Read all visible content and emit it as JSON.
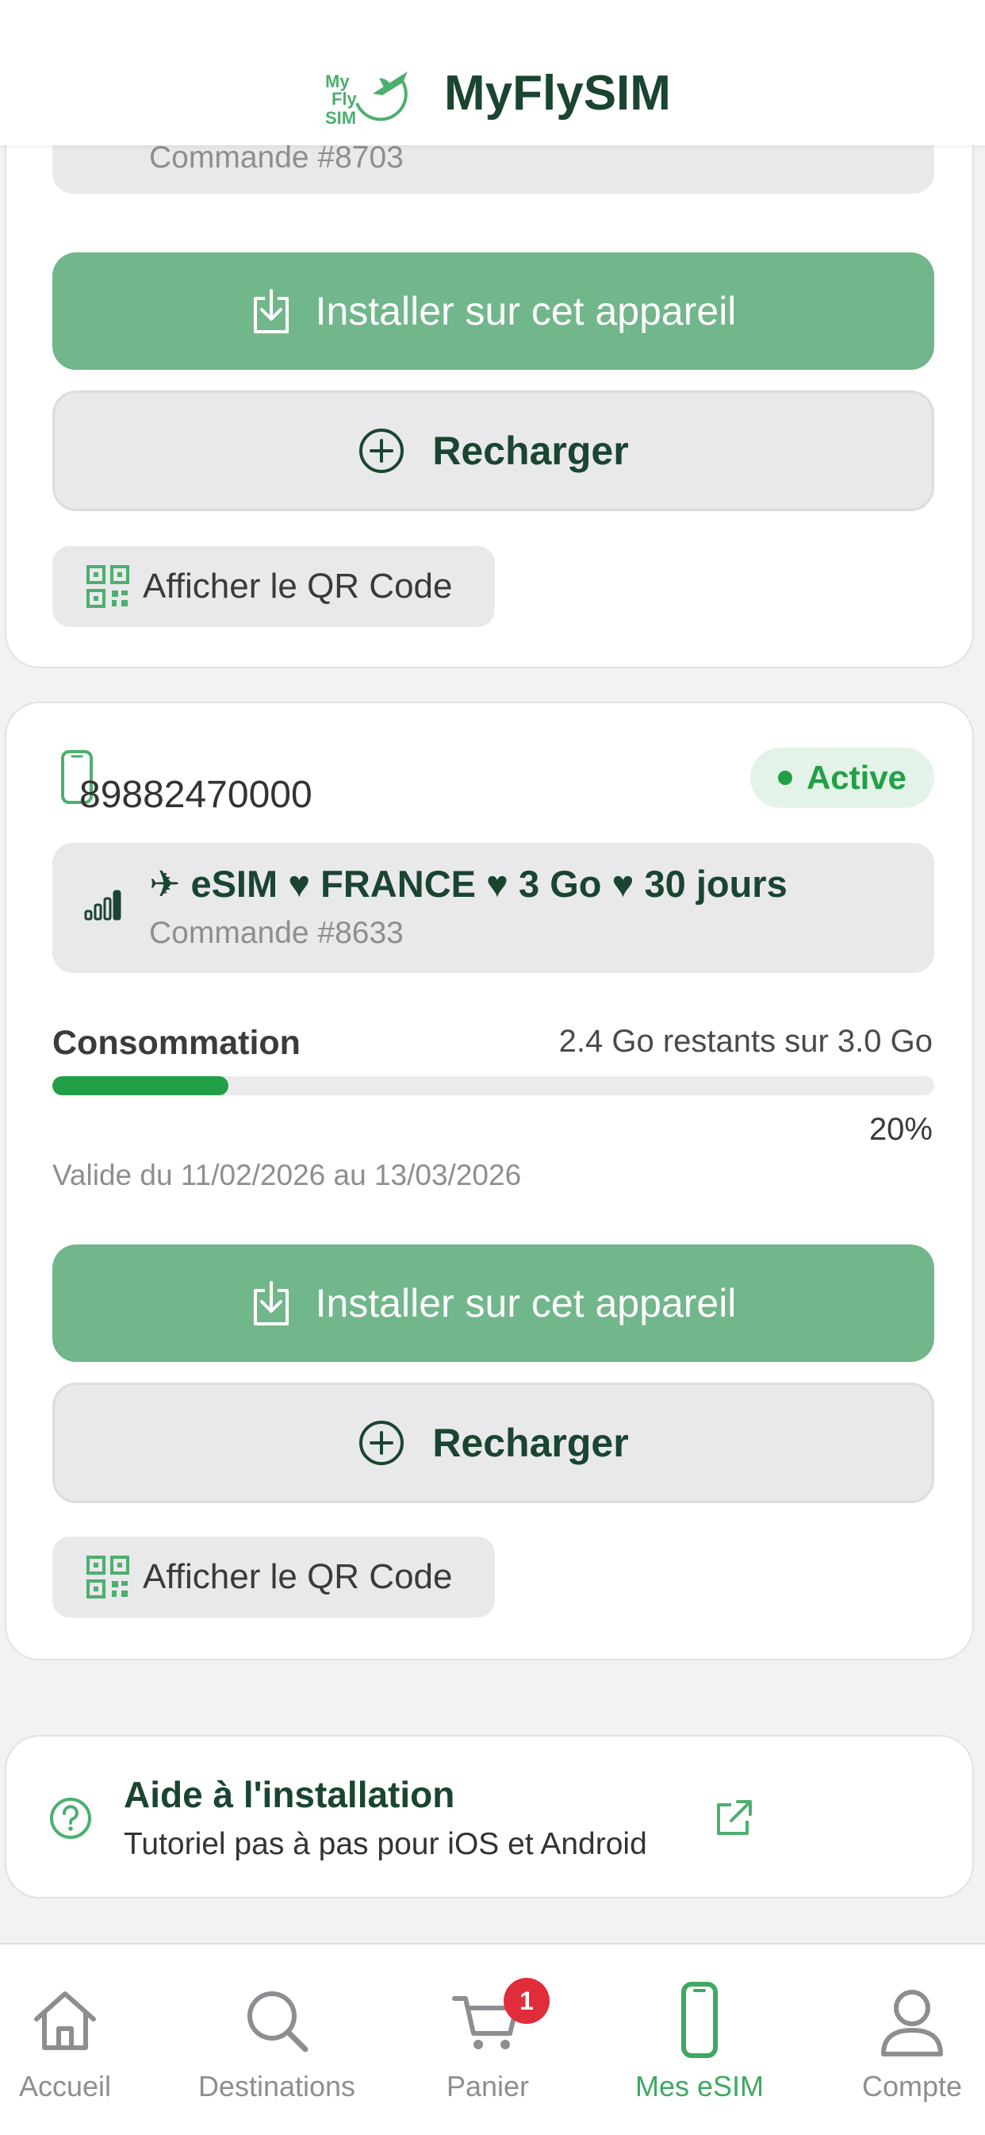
{
  "header": {
    "title": "MyFlySIM",
    "status_fragment": "",
    "logo_text_lines": [
      "My",
      "Fly",
      "SIM"
    ]
  },
  "esim_1": {
    "order_number": "Commande #8703",
    "install_label": "Installer sur cet appareil",
    "recharge_label": "Recharger",
    "qr_label": "Afficher le QR Code"
  },
  "esim_2": {
    "iccid_visible": "89882470000",
    "status": "Active",
    "order_title": "✈ eSIM ♥ FRANCE ♥ 3 Go ♥ 30 jours",
    "order_number": "Commande #8633",
    "consumption_label": "Consommation",
    "consumption_value": "2.4 Go restants sur 3.0 Go",
    "usage_percent_label": "20%",
    "usage_fraction": 0.2,
    "validity": "Valide du 11/02/2026 au 13/03/2026",
    "install_label": "Installer sur cet appareil",
    "recharge_label": "Recharger",
    "qr_label": "Afficher le QR Code"
  },
  "help": {
    "title": "Aide à l'installation",
    "subtitle": "Tutoriel pas à pas pour iOS et Android"
  },
  "tabbar": {
    "items": [
      {
        "label": "Accueil",
        "icon": "home-icon"
      },
      {
        "label": "Destinations",
        "icon": "search-icon"
      },
      {
        "label": "Panier",
        "icon": "cart-icon",
        "badge": "1"
      },
      {
        "label": "Mes eSIM",
        "icon": "phone-icon",
        "active": true
      },
      {
        "label": "Compte",
        "icon": "user-icon"
      }
    ]
  },
  "colors": {
    "brand_dark": "#1a4530",
    "install_button": "#72b68b",
    "active_green": "#22a047",
    "cart_badge": "#e12d3a"
  }
}
